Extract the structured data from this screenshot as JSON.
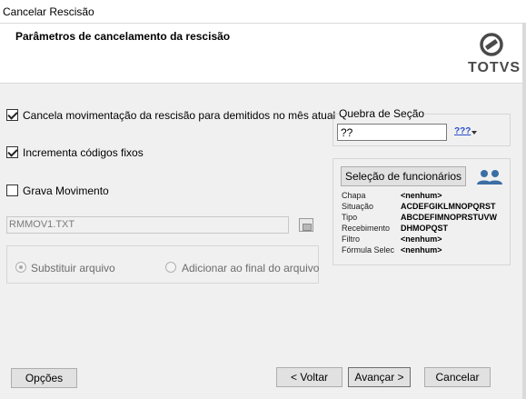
{
  "window": {
    "title": "Cancelar Rescisão"
  },
  "header": {
    "heading": "Parâmetros de cancelamento da rescisão",
    "logo_text": "TOTVS"
  },
  "options": {
    "cancel_movement": {
      "label": "Cancela movimentação da rescisão para demitidos no mês atual",
      "checked": true
    },
    "increment_codes": {
      "label": "Incrementa códigos fixos",
      "checked": true
    },
    "save_movement": {
      "label": "Grava Movimento",
      "checked": false
    }
  },
  "file": {
    "value": "RMMOV1.TXT",
    "radio_options": [
      {
        "label": "Substituir arquivo",
        "selected": true
      },
      {
        "label": "Adicionar ao final do arquivo",
        "selected": false
      }
    ]
  },
  "section_break": {
    "label": "Quebra de Seção",
    "value": "??",
    "picker_glyph": "???"
  },
  "employee_selection": {
    "button_label": "Seleção de funcionários",
    "fields": [
      {
        "key": "Chapa",
        "value": "<nenhum>"
      },
      {
        "key": "Situação",
        "value": "ACDEFGIKLMNOPQRST"
      },
      {
        "key": "Tipo",
        "value": "ABCDEFIMNOPRSTUVW"
      },
      {
        "key": "Recebimento",
        "value": "DHMOPQST"
      },
      {
        "key": "Filtro",
        "value": "<nenhum>"
      },
      {
        "key": "Fórmula Selec",
        "value": "<nenhum>"
      }
    ]
  },
  "footer": {
    "options": "Opções",
    "back": "< Voltar",
    "next": "Avançar >",
    "cancel": "Cancelar"
  },
  "colors": {
    "window_bg": "#f0f0f0",
    "header_bg": "#ffffff",
    "logo_gray": "#4a4a4a",
    "people_icon_blue": "#3a6ea5"
  }
}
